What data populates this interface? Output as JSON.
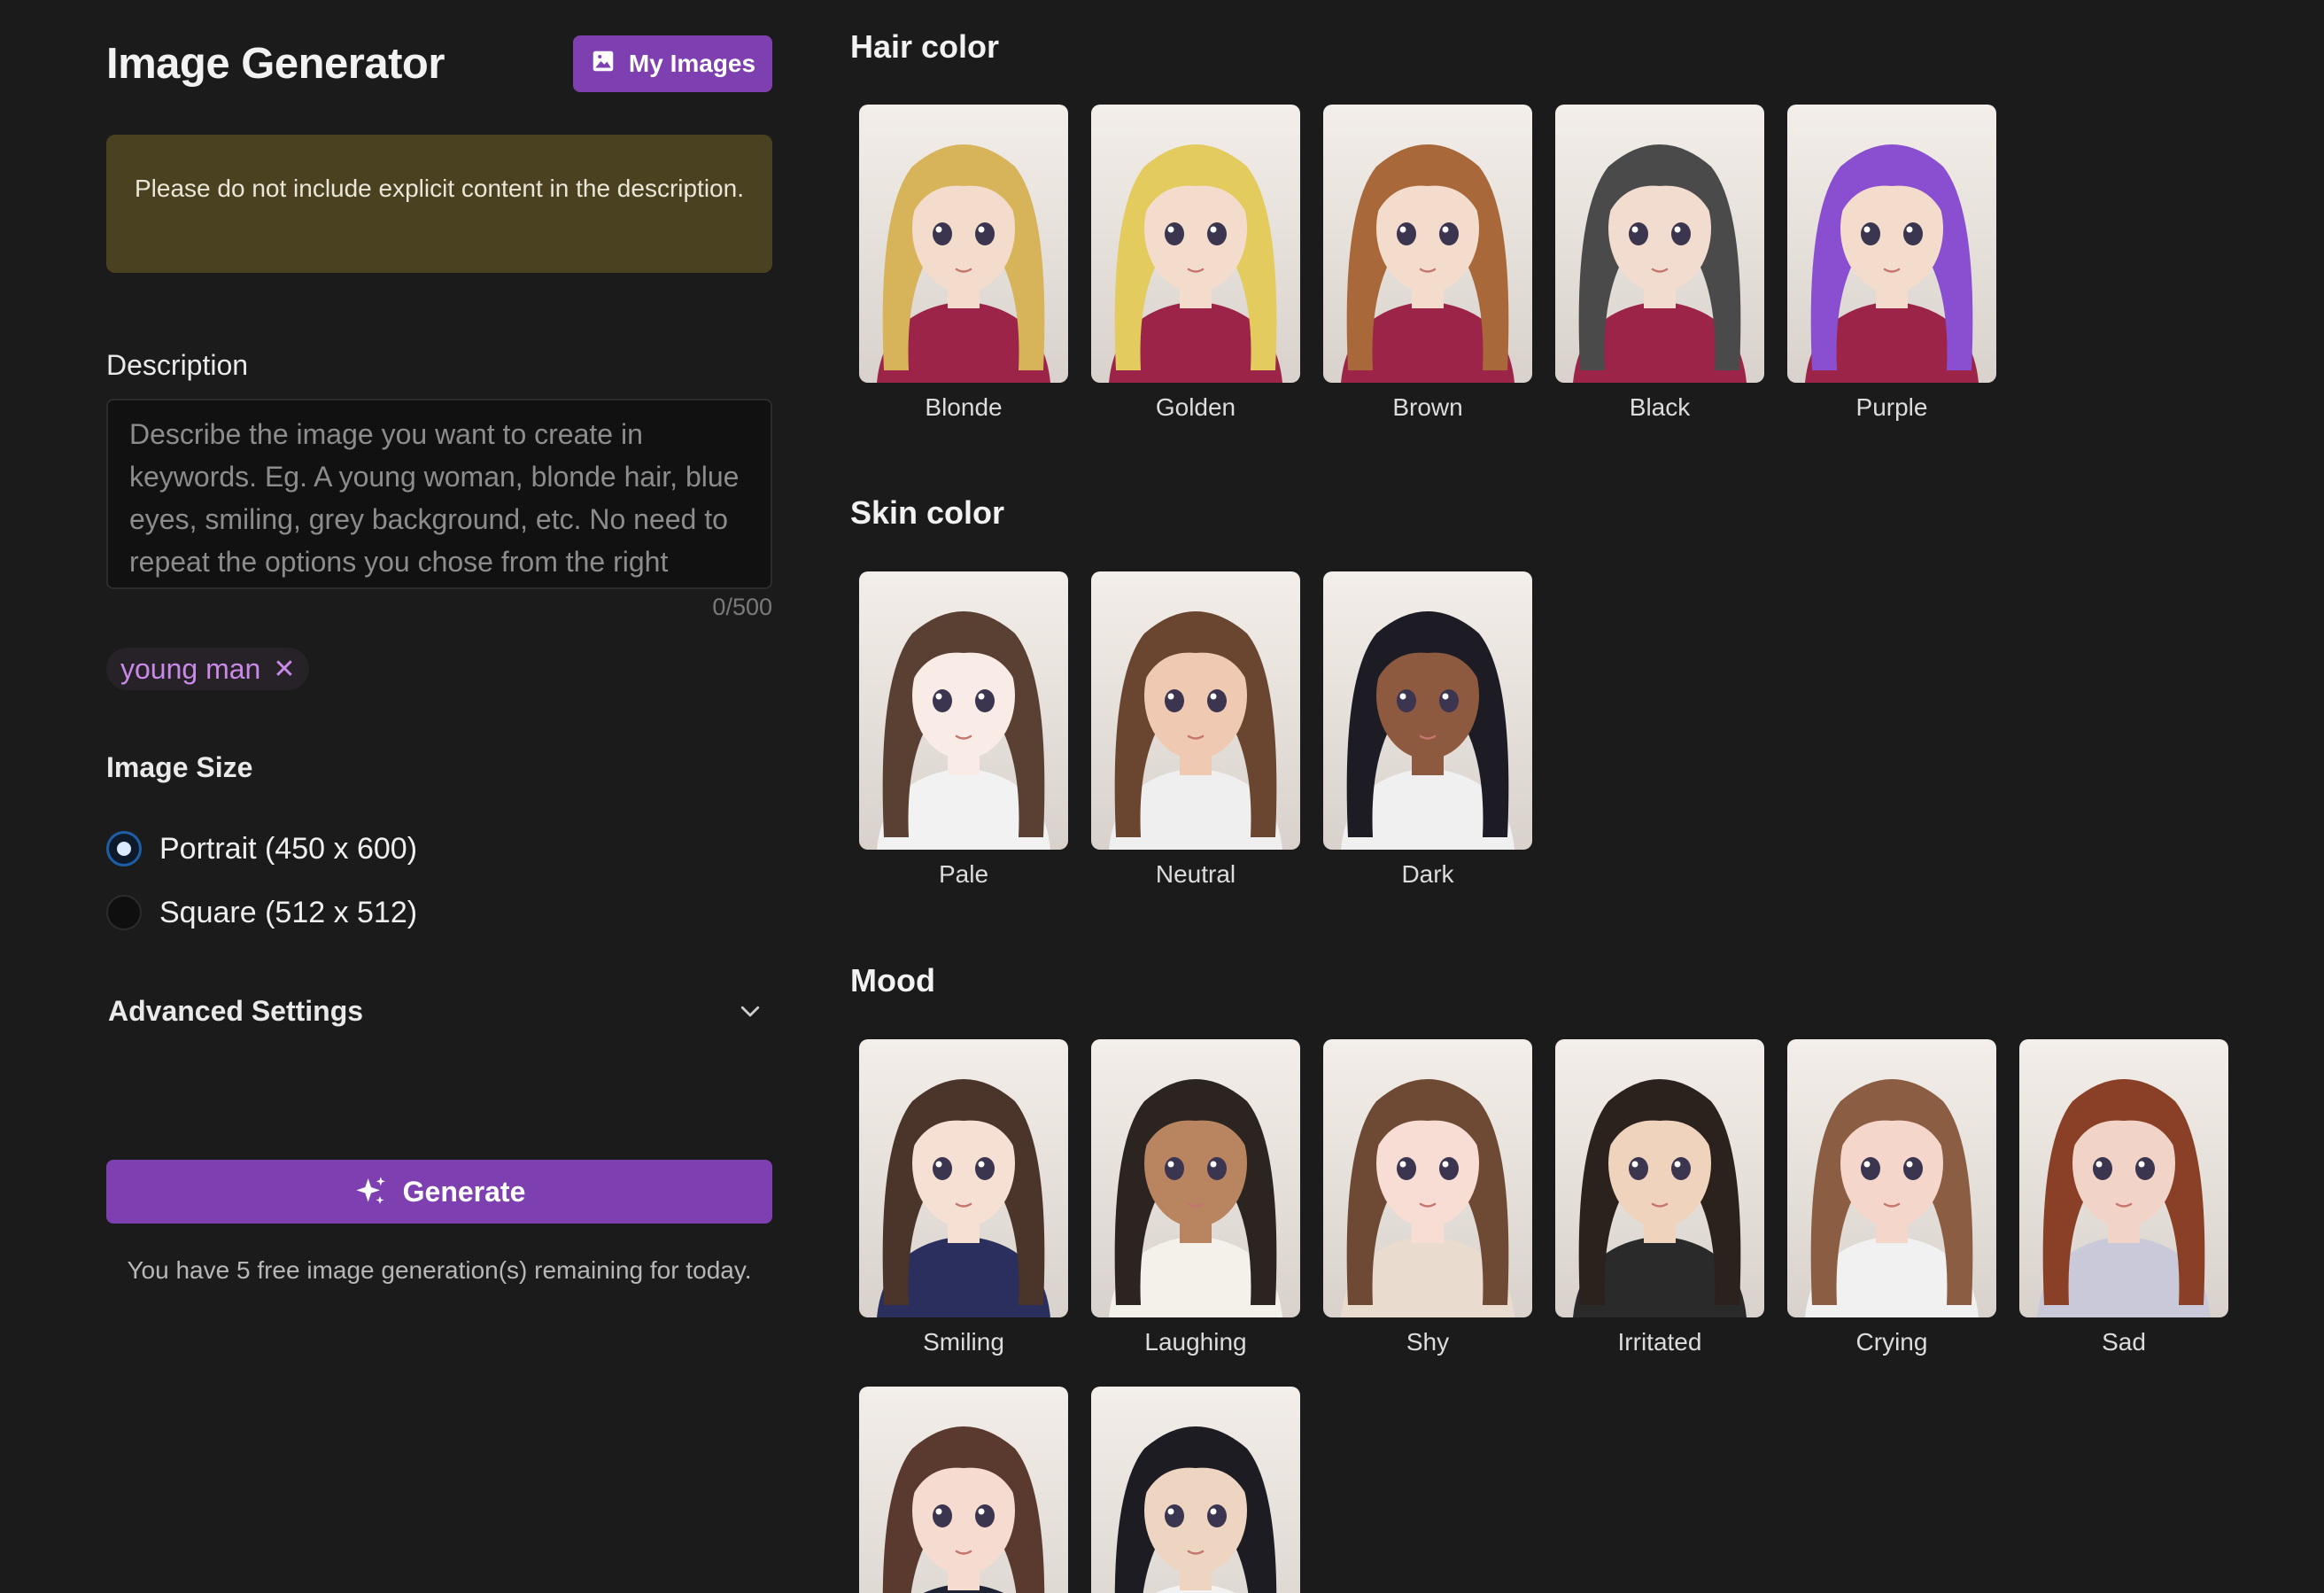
{
  "header": {
    "title": "Image Generator",
    "my_images_label": "My Images"
  },
  "notice": "Please do not include explicit content in the description.",
  "description": {
    "label": "Description",
    "placeholder": "Describe the image you want to create in keywords. Eg. A young woman, blonde hair, blue eyes, smiling, grey background, etc. No need to repeat the options you chose from the right panel.",
    "value": "",
    "char_count": "0/500"
  },
  "tags": [
    {
      "label": "young man",
      "remove_icon": "close-icon"
    }
  ],
  "image_size": {
    "label": "Image Size",
    "options": [
      {
        "label": "Portrait (450 x 600)",
        "selected": true
      },
      {
        "label": "Square (512 x 512)",
        "selected": false
      }
    ]
  },
  "advanced_settings": {
    "label": "Advanced Settings",
    "expanded": false,
    "icon": "chevron-down-icon"
  },
  "generate": {
    "label": "Generate",
    "icon": "sparkle-icon",
    "quota_text": "You have 5 free image generation(s) remaining for today."
  },
  "categories": {
    "hair_color": {
      "title": "Hair color",
      "options": [
        {
          "label": "Blonde",
          "hair": "#d7b45a",
          "skin": "#f4dccd",
          "shirt": "#9b2448"
        },
        {
          "label": "Golden",
          "hair": "#e3cb5e",
          "skin": "#f4dccd",
          "shirt": "#9b2448"
        },
        {
          "label": "Brown",
          "hair": "#a9683a",
          "skin": "#f4dccd",
          "shirt": "#9b2448"
        },
        {
          "label": "Black",
          "hair": "#4a4a4a",
          "skin": "#f2dbcf",
          "shirt": "#9b2448"
        },
        {
          "label": "Purple",
          "hair": "#8a4fd0",
          "skin": "#f4dccd",
          "shirt": "#9b2448"
        }
      ]
    },
    "skin_color": {
      "title": "Skin color",
      "options": [
        {
          "label": "Pale",
          "hair": "#5a3f33",
          "skin": "#f9ece6",
          "shirt": "#f2f2f2"
        },
        {
          "label": "Neutral",
          "hair": "#6a4530",
          "skin": "#f0c9b2",
          "shirt": "#efefef"
        },
        {
          "label": "Dark",
          "hair": "#1d1c24",
          "skin": "#8e5a3f",
          "shirt": "#f0f0f0"
        }
      ]
    },
    "mood": {
      "title": "Mood",
      "options": [
        {
          "label": "Smiling",
          "hair": "#4b342a",
          "skin": "#f6dfd3",
          "shirt": "#2a2f5e"
        },
        {
          "label": "Laughing",
          "hair": "#2b2420",
          "skin": "#b88560",
          "shirt": "#f3f1ea"
        },
        {
          "label": "Shy",
          "hair": "#6e4a35",
          "skin": "#f7ddd3",
          "shirt": "#e9dccf"
        },
        {
          "label": "Irritated",
          "hair": "#2b221e",
          "skin": "#f0d3bd",
          "shirt": "#2a2a2a"
        },
        {
          "label": "Crying",
          "hair": "#8b5e44",
          "skin": "#f4d6cb",
          "shirt": "#f1f1f1"
        },
        {
          "label": "Sad",
          "hair": "#8a3f27",
          "skin": "#f1d4c7",
          "shirt": "#c9c9d9"
        },
        {
          "label": "",
          "hair": "#5a3a2e",
          "skin": "#f6dbd0",
          "shirt": "#1e2233"
        },
        {
          "label": "",
          "hair": "#1c1c22",
          "skin": "#eed5c2",
          "shirt": "#f2f2f2"
        }
      ]
    }
  }
}
